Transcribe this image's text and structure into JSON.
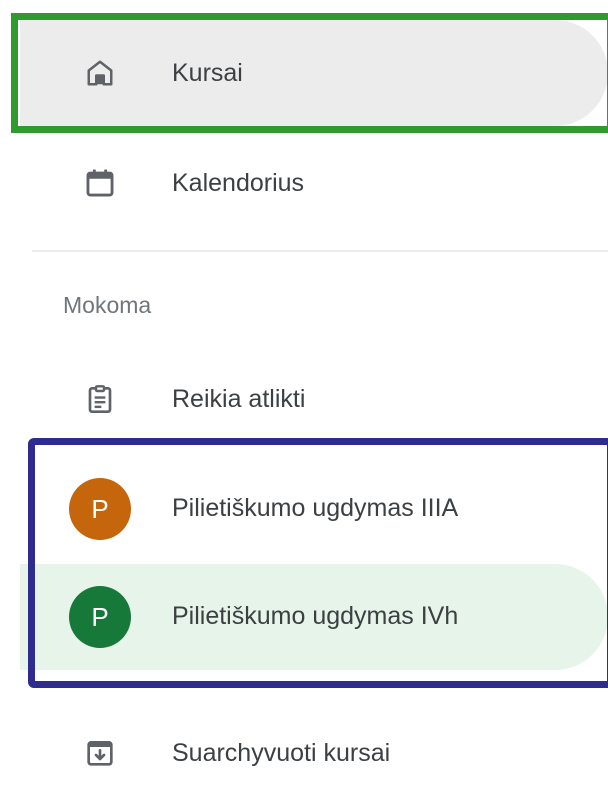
{
  "nav": {
    "courses": {
      "label": "Kursai",
      "icon": "home-icon",
      "selected": true
    },
    "calendar": {
      "label": "Kalendorius",
      "icon": "calendar-icon"
    }
  },
  "teaching": {
    "heading": "Mokoma",
    "todo": {
      "label": "Reikia atlikti",
      "icon": "assignment-icon"
    },
    "classes": [
      {
        "initial": "P",
        "name": "Pilietiškumo ugdymas IIIA",
        "color": "#c5650c"
      },
      {
        "initial": "P",
        "name": "Pilietiškumo ugdymas IVh",
        "color": "#16793a",
        "selected": true
      }
    ]
  },
  "archived": {
    "label": "Suarchyvuoti kursai",
    "icon": "archive-icon"
  },
  "colors": {
    "selected_bg": "#ececec",
    "class_selected_bg": "#e6f4ea",
    "highlight_green": "#2f9a2f",
    "highlight_blue": "#2e2c8f"
  }
}
